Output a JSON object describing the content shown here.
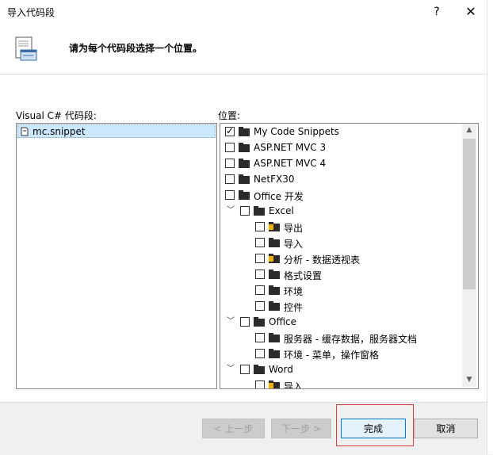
{
  "window": {
    "title": "导入代码段",
    "help_label": "?",
    "close_label": "✕"
  },
  "header": {
    "instruction": "请为每个代码段选择一个位置。"
  },
  "left_panel": {
    "label": "Visual C# 代码段:",
    "items": [
      {
        "label": "mc.snippet",
        "selected": true
      }
    ]
  },
  "right_panel": {
    "label": "位置:",
    "tree": [
      {
        "label": "My Code Snippets",
        "checked": true
      },
      {
        "label": "ASP.NET MVC 3",
        "checked": false
      },
      {
        "label": "ASP.NET MVC 4",
        "checked": false
      },
      {
        "label": "NetFX30",
        "checked": false
      },
      {
        "label": "Office 开发",
        "checked": false
      },
      {
        "label": "Excel",
        "checked": false,
        "expanded": true
      },
      {
        "label": "导出",
        "checked": false,
        "icon": "folder-warning-icon"
      },
      {
        "label": "导入",
        "checked": false
      },
      {
        "label": "分析 - 数据透视表",
        "checked": false,
        "icon": "folder-warning-icon"
      },
      {
        "label": "格式设置",
        "checked": false
      },
      {
        "label": "环境",
        "checked": false
      },
      {
        "label": "控件",
        "checked": false
      },
      {
        "label": "Office",
        "checked": false,
        "expanded": true
      },
      {
        "label": "服务器 - 缓存数据，服务器文档",
        "checked": false
      },
      {
        "label": "环境 - 菜单，操作窗格",
        "checked": false
      },
      {
        "label": "Word",
        "checked": false,
        "expanded": true
      },
      {
        "label": "导入",
        "checked": false,
        "icon": "folder-warning-icon"
      }
    ]
  },
  "buttons": {
    "prev": "< 上一步",
    "next": "下一步 >",
    "finish": "完成",
    "cancel": "取消"
  },
  "colors": {
    "selection": "#cce8ff",
    "highlight_box": "#e0393e",
    "accent_border": "#0078d7"
  }
}
